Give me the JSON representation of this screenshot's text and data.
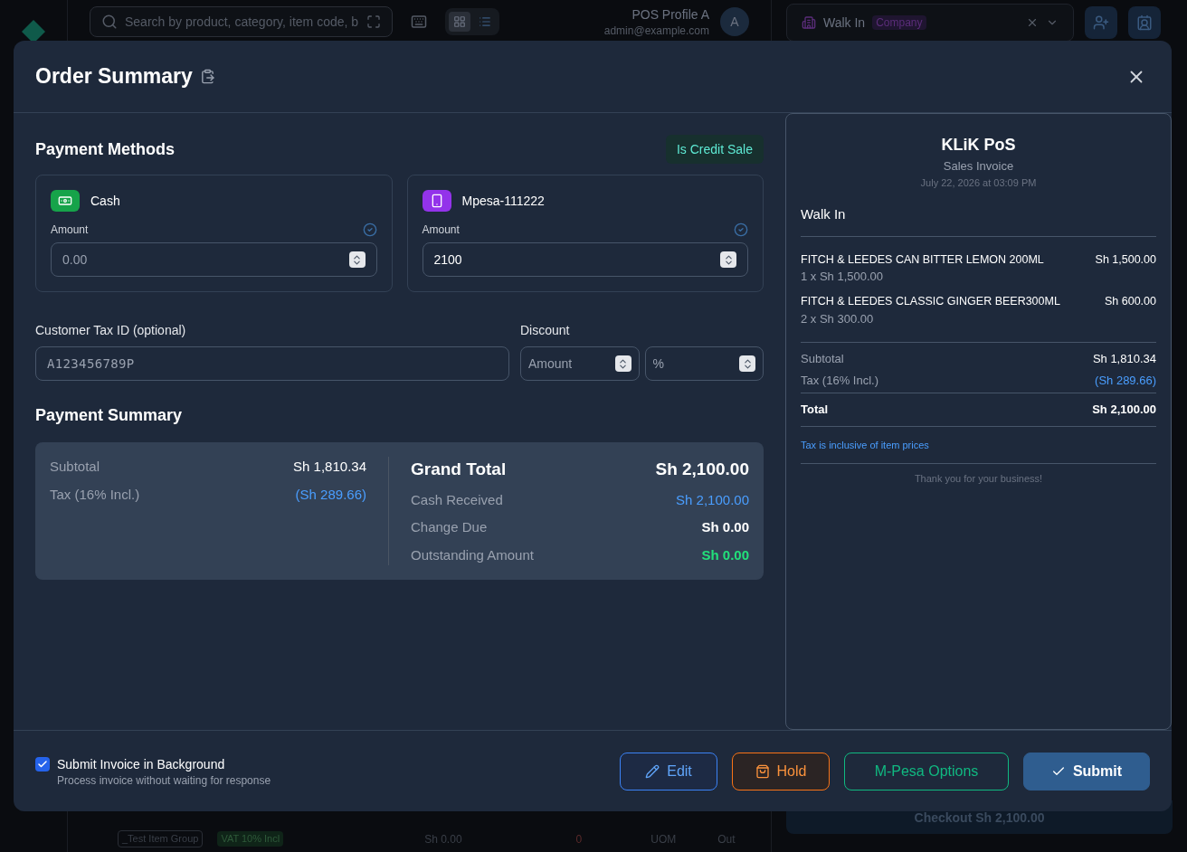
{
  "background": {
    "search": {
      "placeholder": "Search by product, category, item code, b"
    },
    "profile": {
      "name": "POS Profile A",
      "email": "admin@example.com",
      "avatar": "A"
    },
    "view_toggle": [
      {
        "kind": "grid",
        "selected": true
      },
      {
        "kind": "list",
        "selected": false
      }
    ],
    "customer": {
      "name": "Walk In",
      "tag": "Company"
    },
    "item_row": {
      "group": "_Test Item Group",
      "tax_tag": "VAT 10% Incl",
      "price": "Sh 0.00",
      "qty": "0",
      "uom": "UOM",
      "status": "Out"
    },
    "checkout": "Checkout Sh 2,100.00"
  },
  "dialog": {
    "title": "Order Summary",
    "payment_methods": {
      "title": "Payment Methods",
      "credit_badge": "Is Credit Sale",
      "methods": [
        {
          "kind": "cash",
          "name": "Cash",
          "color": "#16a34a",
          "amount_label": "Amount",
          "placeholder": "0.00"
        },
        {
          "kind": "mobile",
          "name": "Mpesa-111222",
          "color": "#9333ea",
          "amount_label": "Amount",
          "value": "2100"
        }
      ]
    },
    "tax_id": {
      "label": "Customer Tax ID (optional)",
      "placeholder": "A123456789P"
    },
    "discount": {
      "label": "Discount",
      "amount_placeholder": "Amount",
      "percent_placeholder": "%"
    },
    "summary": {
      "title": "Payment Summary",
      "left": [
        {
          "label": "Subtotal",
          "value": "Sh 1,810.34",
          "kind": "plain"
        },
        {
          "label": "Tax (16% Incl.)",
          "value": "(Sh 289.66)",
          "kind": "blue"
        }
      ],
      "grand_total": {
        "label": "Grand Total",
        "value": "Sh 2,100.00"
      },
      "right": [
        {
          "label": "Cash Received",
          "value": "Sh 2,100.00",
          "kind": "blue"
        },
        {
          "label": "Change Due",
          "value": "Sh 0.00",
          "kind": "bold"
        },
        {
          "label": "Outstanding Amount",
          "value": "Sh 0.00",
          "kind": "green"
        }
      ]
    },
    "receipt": {
      "store": "KLiK PoS",
      "doc_type": "Sales Invoice",
      "date": "July 22, 2026 at 03:09 PM",
      "customer": "Walk In",
      "items": [
        {
          "name": "FITCH & LEEDES CAN BITTER LEMON 200ML",
          "amount": "Sh 1,500.00",
          "detail": "1 x Sh 1,500.00"
        },
        {
          "name": "FITCH & LEEDES CLASSIC GINGER BEER300ML",
          "amount": "Sh 600.00",
          "detail": "2 x Sh 300.00"
        }
      ],
      "subtotal": {
        "label": "Subtotal",
        "value": "Sh 1,810.34"
      },
      "tax": {
        "label": "Tax (16% Incl.)",
        "value": "(Sh 289.66)"
      },
      "total": {
        "label": "Total",
        "value": "Sh 2,100.00"
      },
      "note": "Tax is inclusive of item prices",
      "thanks": "Thank you for your business!"
    },
    "background_submit": {
      "label": "Submit Invoice in Background",
      "hint": "Process invoice without waiting for response",
      "checked": true
    },
    "buttons": [
      {
        "kind": "edit",
        "label": "Edit"
      },
      {
        "kind": "hold",
        "label": "Hold"
      },
      {
        "kind": "mpesa",
        "label": "M-Pesa Options"
      },
      {
        "kind": "submit",
        "label": "Submit"
      }
    ]
  }
}
